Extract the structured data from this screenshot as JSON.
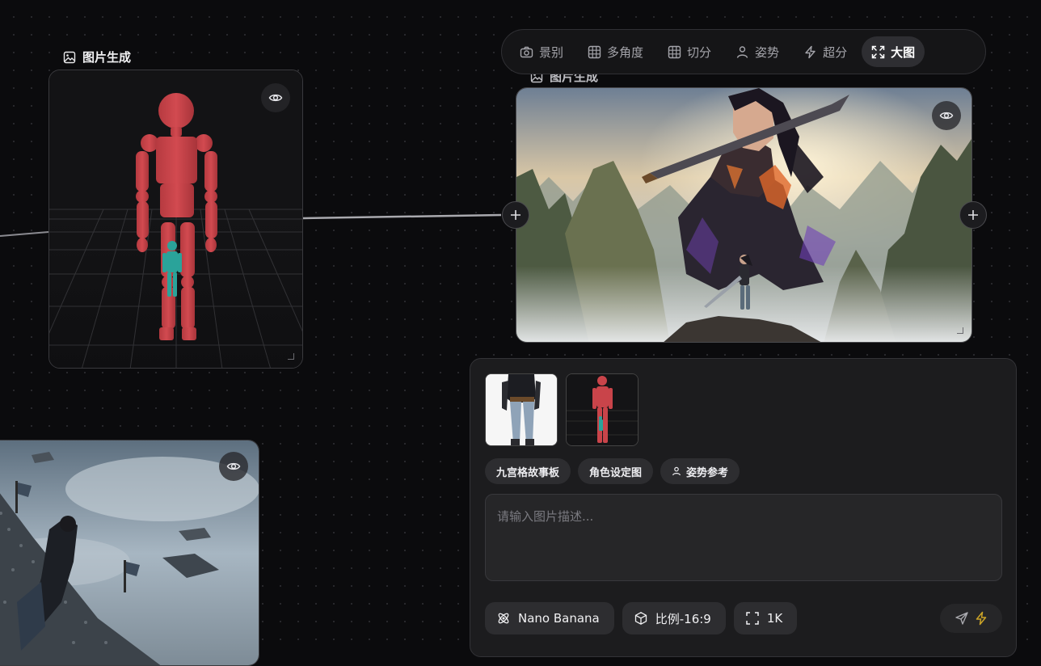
{
  "nodes": {
    "pose_node": {
      "label": "图片生成",
      "icon": "image-icon"
    },
    "main_node": {
      "label": "图片生成",
      "icon": "image-icon"
    },
    "bottom_node": {
      "icon": "eye-icon"
    }
  },
  "toolbar": {
    "items": [
      {
        "label": "景别",
        "icon": "camera-icon"
      },
      {
        "label": "多角度",
        "icon": "grid-icon"
      },
      {
        "label": "切分",
        "icon": "grid-icon"
      },
      {
        "label": "姿势",
        "icon": "person-icon"
      },
      {
        "label": "超分",
        "icon": "lightning-icon"
      },
      {
        "label": "大图",
        "icon": "expand-icon",
        "active": true
      }
    ]
  },
  "panel": {
    "references": [
      "reference-thumbnail-character",
      "reference-thumbnail-pose"
    ],
    "chips": [
      {
        "label": "九宫格故事板"
      },
      {
        "label": "角色设定图"
      },
      {
        "label": "姿势参考",
        "icon": "person-icon"
      }
    ],
    "prompt": {
      "placeholder": "请输入图片描述...",
      "value": ""
    },
    "options": {
      "model": "Nano Banana",
      "ratio": "比例-16:9",
      "resolution": "1K"
    },
    "send": {
      "icon": "send-icon",
      "accent": "#c9a227"
    }
  },
  "colors": {
    "background": "#0b0b0d",
    "mannequin": "#c9444a",
    "figure": "#2aa39a",
    "active_tab": "#2e2e32"
  }
}
